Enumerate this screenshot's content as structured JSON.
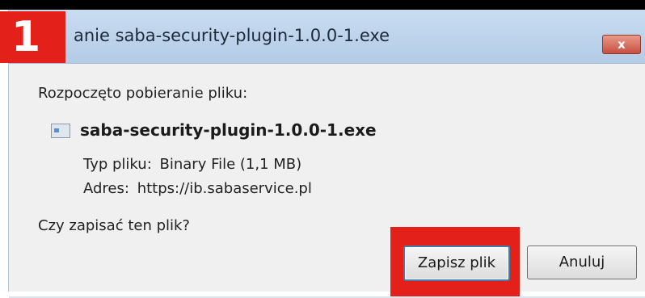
{
  "dialog": {
    "title": "anie saba-security-plugin-1.0.0-1.exe",
    "close_label": "x",
    "started_label": "Rozpoczęto pobieranie pliku:",
    "file_name": "saba-security-plugin-1.0.0-1.exe",
    "type_label": "Typ pliku:",
    "type_value": "Binary File (1,1 MB)",
    "address_label": "Adres:",
    "address_value": "https://ib.sabaservice.pl",
    "question": "Czy zapisać ten plik?",
    "save_button": "Zapisz plik",
    "cancel_button": "Anuluj"
  },
  "overlay": {
    "step_number": "1",
    "highlight_color": "#e4201b"
  },
  "icons": {
    "file": "file-icon",
    "close": "close-icon"
  }
}
